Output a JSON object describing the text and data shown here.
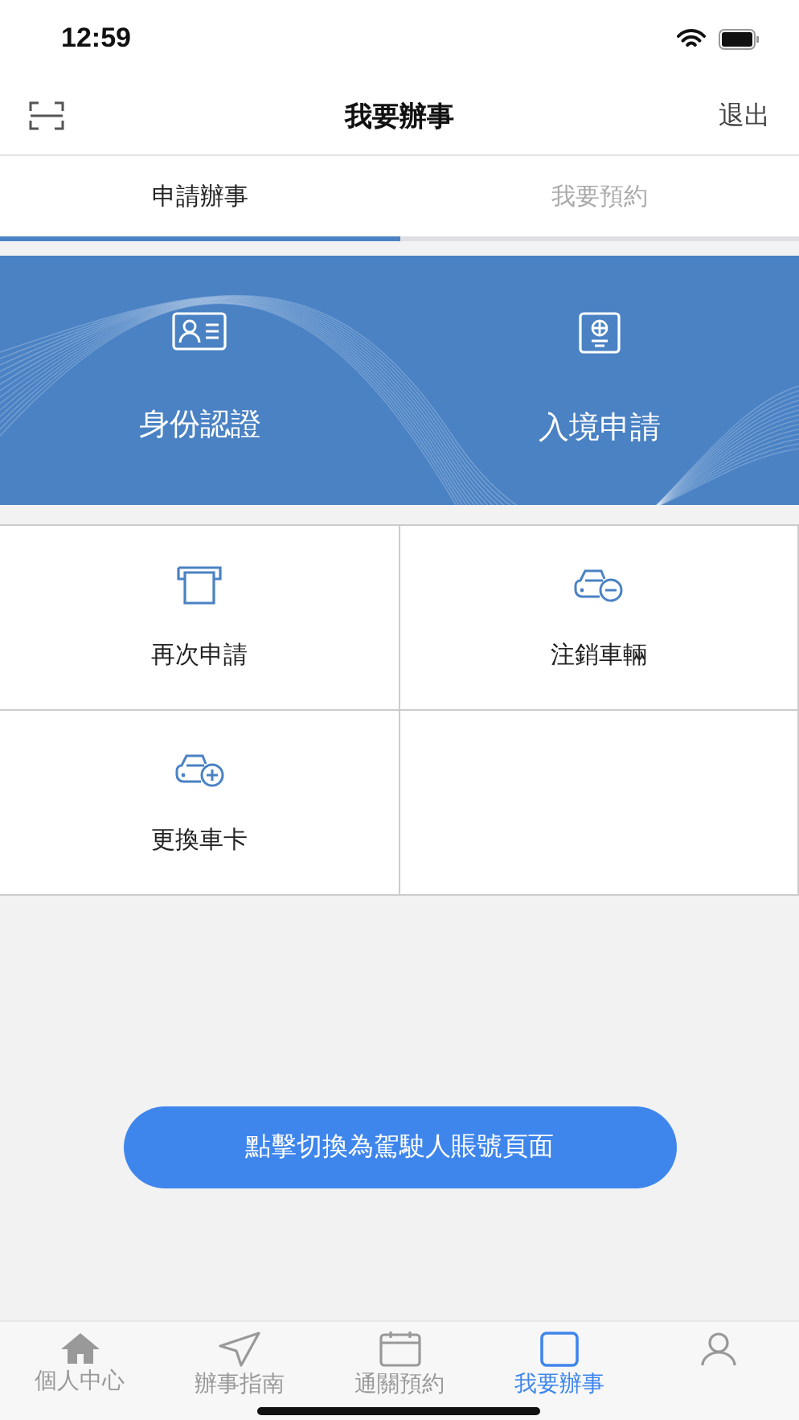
{
  "status_bar": {
    "time": "12:59"
  },
  "header": {
    "title": "我要辦事",
    "action": "退出"
  },
  "tabs": [
    {
      "label": "申請辦事",
      "selected": true
    },
    {
      "label": "我要預約",
      "selected": false
    }
  ],
  "banner_items": [
    {
      "label": "身份認證"
    },
    {
      "label": "入境申請"
    }
  ],
  "grid_items": [
    {
      "label": "再次申請"
    },
    {
      "label": "注銷車輛"
    },
    {
      "label": "更換車卡"
    }
  ],
  "switch_button": "點擊切換為駕駛人賬號頁面",
  "bottom_nav": [
    {
      "label": "個人中心",
      "selected": false
    },
    {
      "label": "辦事指南",
      "selected": false
    },
    {
      "label": "通關預約",
      "selected": false
    },
    {
      "label": "我要辦事",
      "selected": true
    },
    {
      "selected": false
    }
  ]
}
